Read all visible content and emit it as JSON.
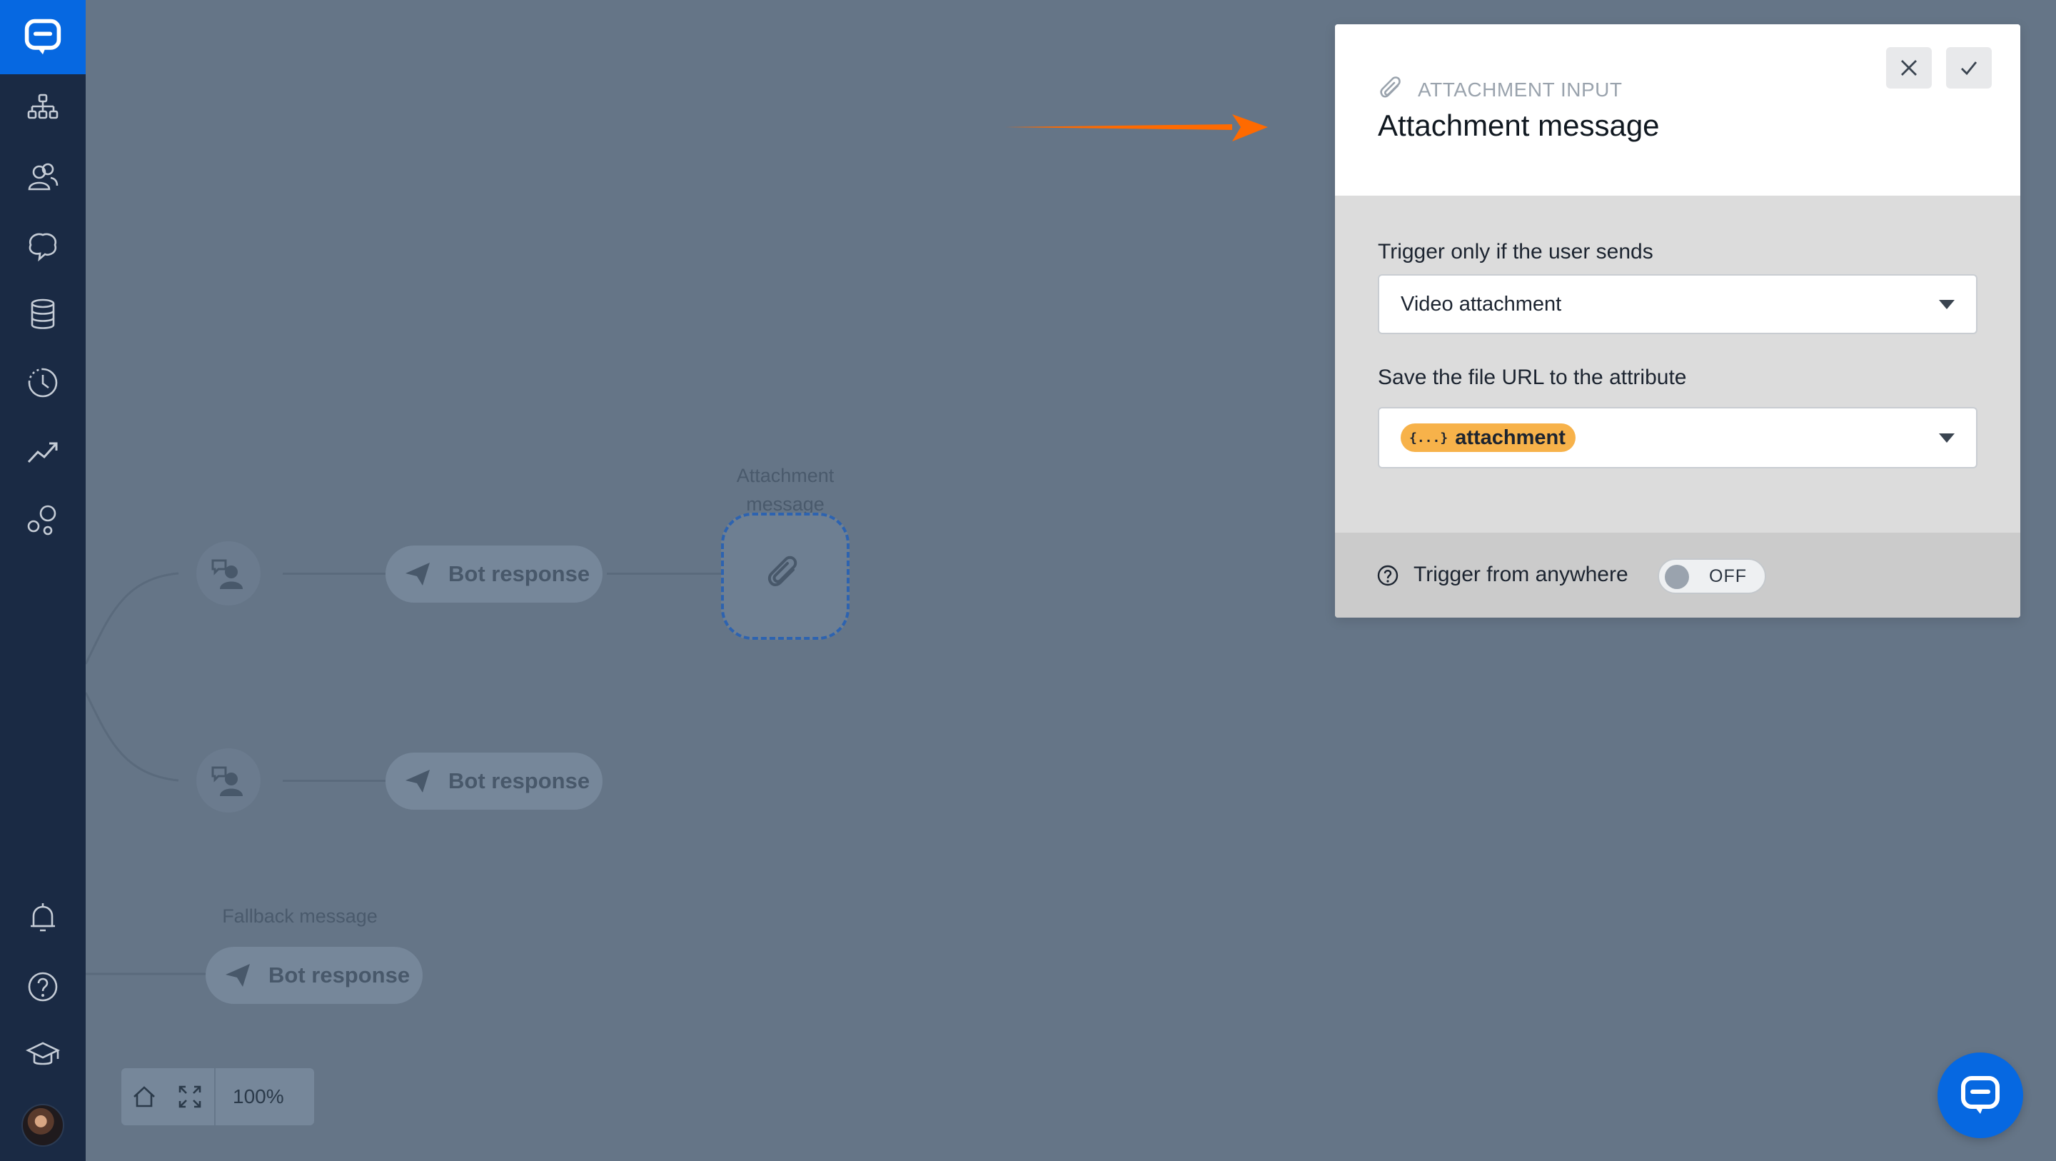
{
  "sidebar": {
    "logo": "chat-logo-icon",
    "items": [
      {
        "name": "sitemap-icon"
      },
      {
        "name": "users-icon"
      },
      {
        "name": "brain-icon"
      },
      {
        "name": "database-icon"
      },
      {
        "name": "history-icon"
      },
      {
        "name": "trending-icon"
      },
      {
        "name": "integrations-icon"
      }
    ],
    "bottom_items": [
      {
        "name": "bell-icon"
      },
      {
        "name": "help-icon"
      },
      {
        "name": "graduation-cap-icon"
      }
    ]
  },
  "canvas": {
    "nodes": {
      "bot_response_1": "Bot response",
      "bot_response_2": "Bot response",
      "bot_response_3": "Bot response",
      "attachment_label": "Attachment message",
      "fallback_label": "Fallback message"
    },
    "zoom_level": "100%"
  },
  "panel": {
    "kicker": "ATTACHMENT INPUT",
    "title": "Attachment message",
    "trigger_label": "Trigger only if the user sends",
    "trigger_value": "Video attachment",
    "save_label": "Save the file URL to the attribute",
    "attribute_icon": "{...}",
    "attribute_value": "attachment",
    "trigger_anywhere_label": "Trigger from anywhere",
    "toggle_state": "OFF"
  },
  "colors": {
    "brand": "#0668e1",
    "sidebar": "#1a2a44",
    "canvas_bg": "#657587",
    "arrow": "#ff6a00",
    "attribute_chip": "#f7b24a"
  }
}
